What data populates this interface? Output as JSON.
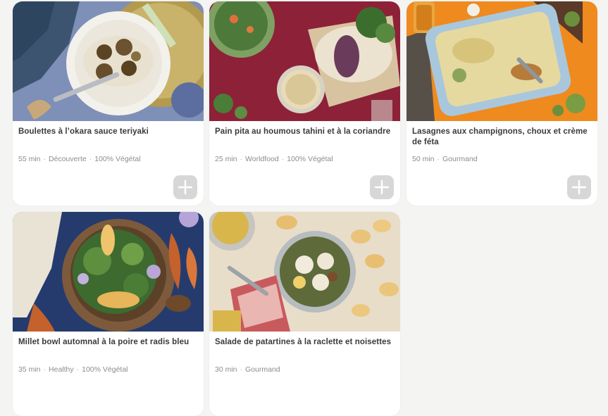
{
  "recipes": [
    {
      "title": "Boulettes à l’okara sauce teriyaki",
      "meta": [
        "55 min",
        "Découverte",
        "100% Végétal"
      ],
      "image_alt": "okara-meatballs-photo"
    },
    {
      "title": "Pain pita au houmous tahini et à la coriandre",
      "meta": [
        "25 min",
        "Worldfood",
        "100% Végétal"
      ],
      "image_alt": "pita-hummus-photo"
    },
    {
      "title": "Lasagnes aux champignons, choux et crème de féta",
      "meta": [
        "50 min",
        "Gourmand"
      ],
      "image_alt": "lasagna-photo"
    },
    {
      "title": "Millet bowl automnal à la poire et radis bleu",
      "meta": [
        "35 min",
        "Healthy",
        "100% Végétal"
      ],
      "image_alt": "millet-bowl-photo"
    },
    {
      "title": "Salade de patartines à la raclette et noisettes",
      "meta": [
        "30 min",
        "Gourmand"
      ],
      "image_alt": "raclette-salad-photo"
    }
  ],
  "add_button_icon": "plus-icon",
  "meta_separator": "·",
  "colors": {
    "page_bg": "#f4f4f3",
    "card_bg": "#ffffff",
    "title_text": "#3a3a3a",
    "meta_text": "#8c8c8c",
    "add_button_bg": "#d7d7d7"
  }
}
